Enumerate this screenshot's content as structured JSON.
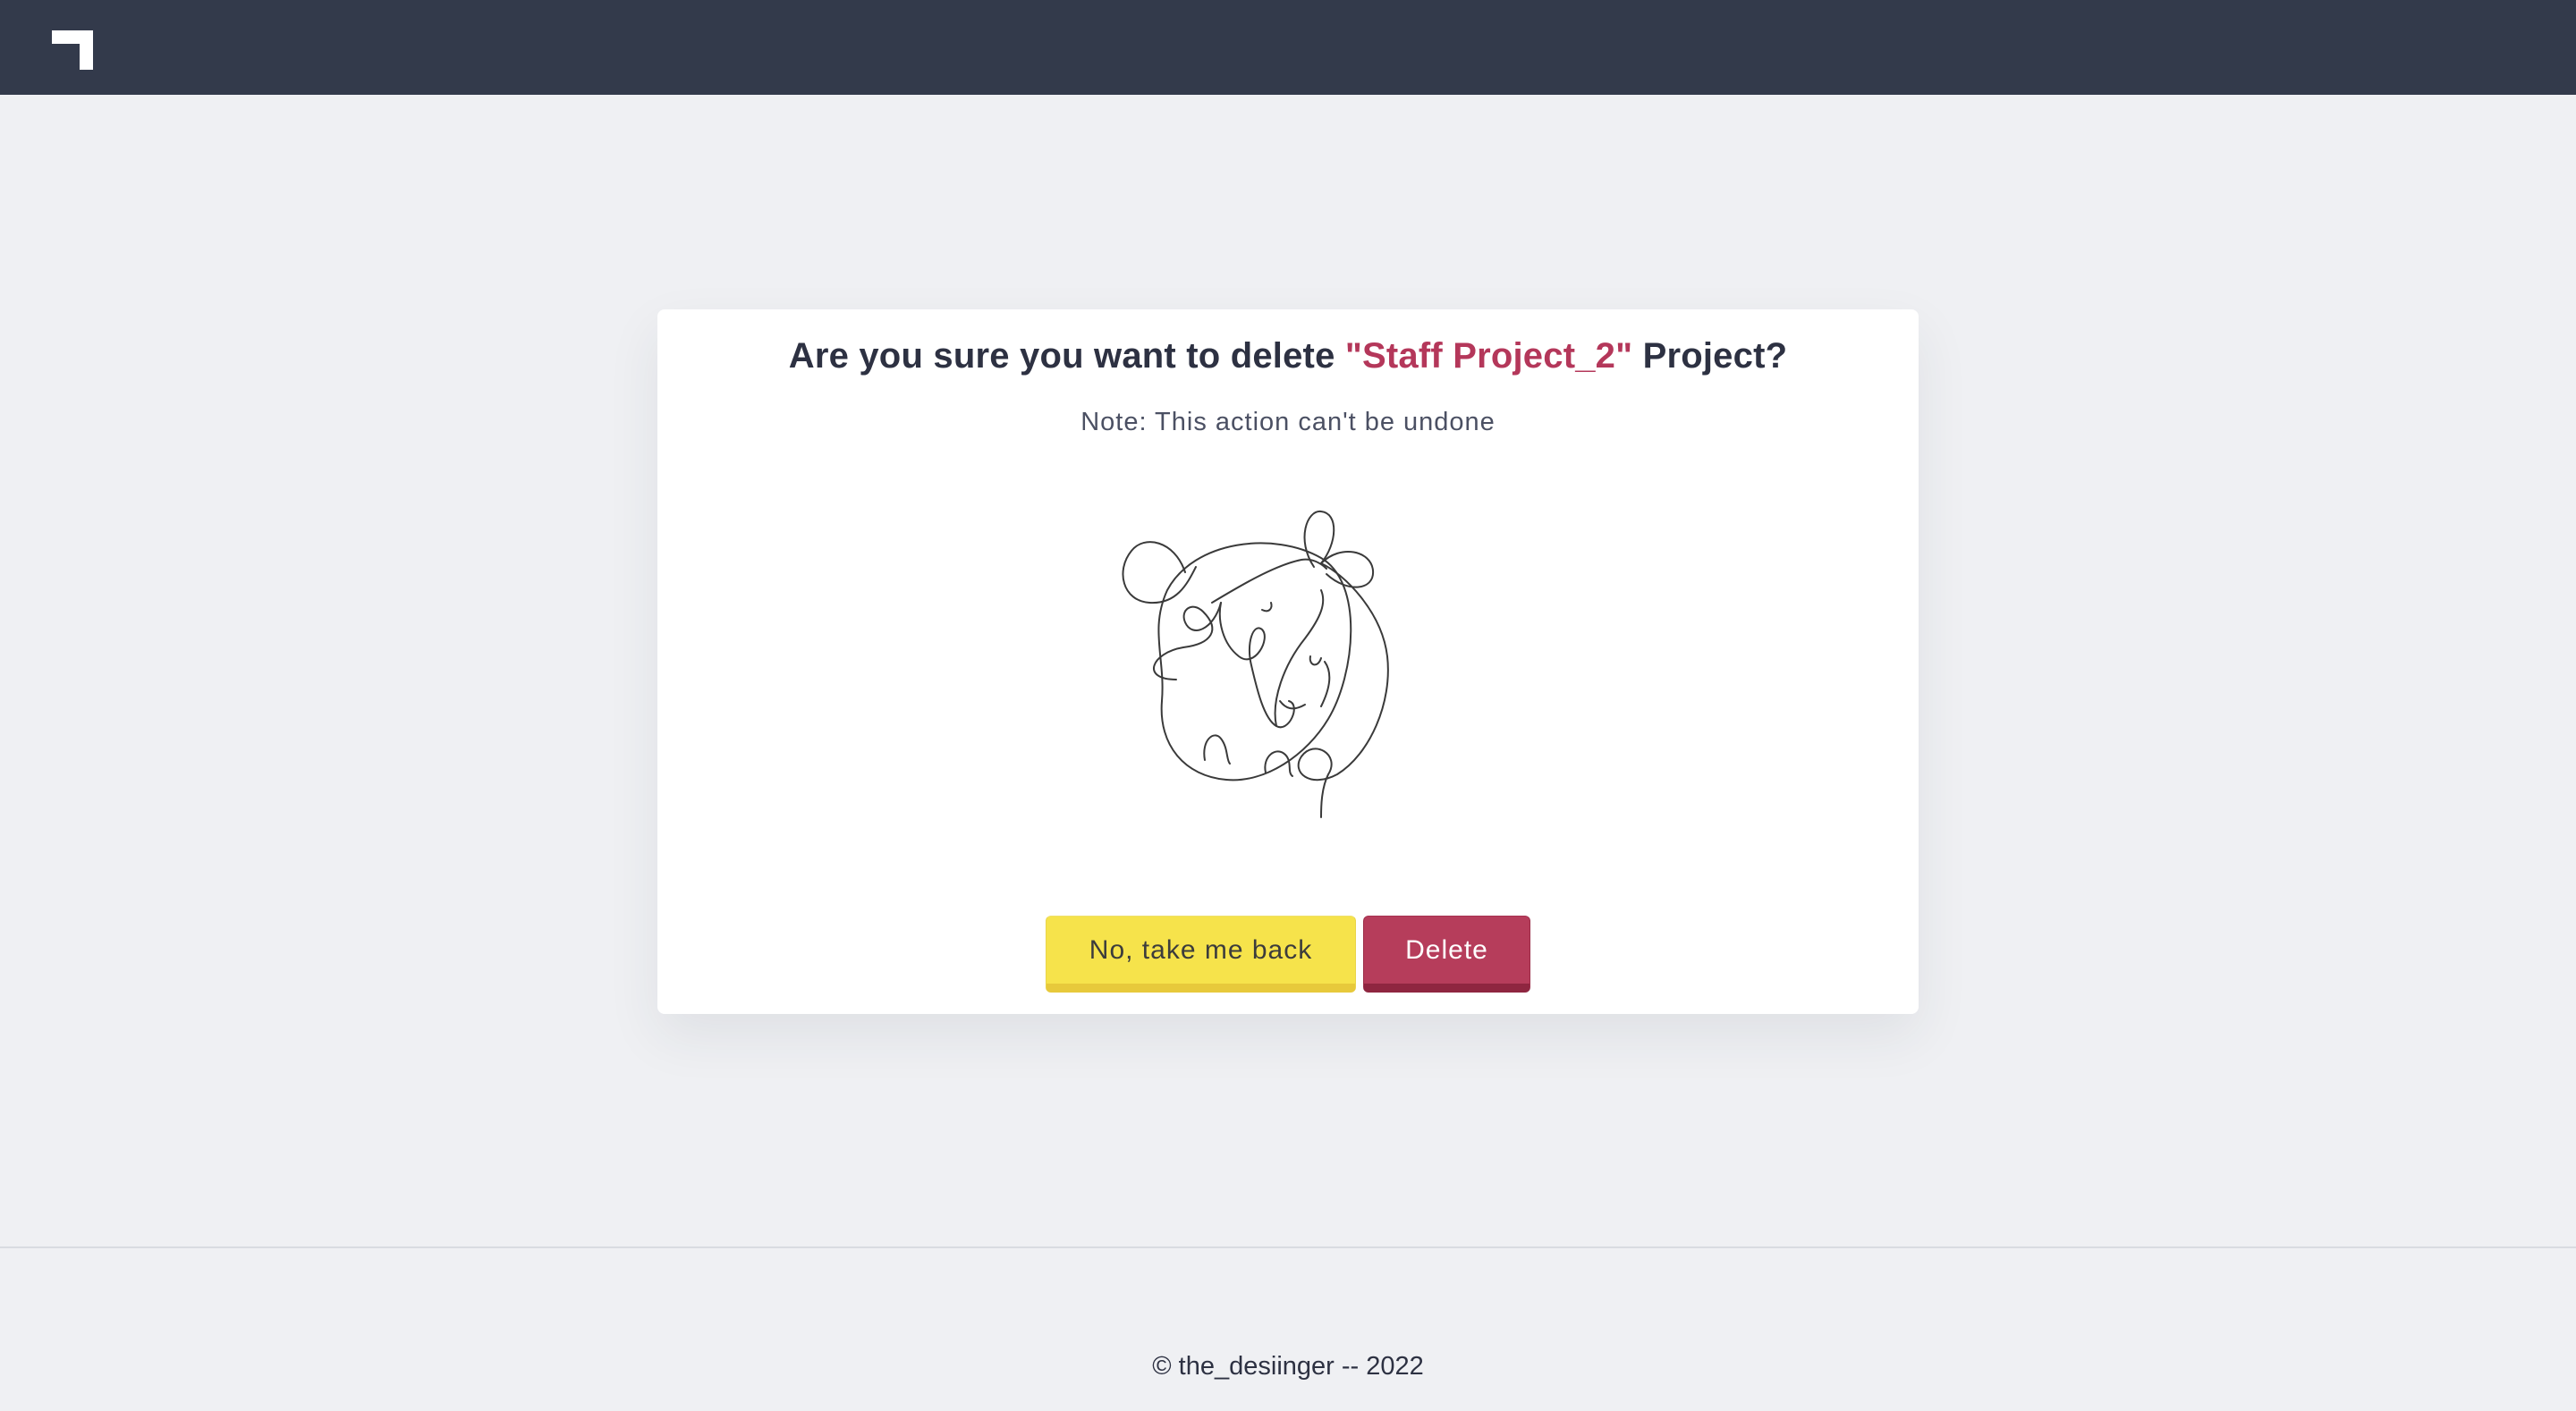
{
  "header": {
    "logo_icon": "corner-bracket-logo-icon",
    "bg_color": "#333a4b"
  },
  "dialog": {
    "title_prefix": "Are you sure you want to delete ",
    "project_name": "\"Staff Project_2\"",
    "title_suffix": " Project?",
    "note": "Note: This action can't be undone",
    "illustration_icon": "scribble-line-art-icon",
    "buttons": {
      "back_label": "No, take me back",
      "delete_label": "Delete"
    },
    "colors": {
      "accent": "#b4375a",
      "back_button": "#f6e34b",
      "delete_button": "#b63d5b"
    }
  },
  "footer": {
    "text": "© the_desiinger -- 2022"
  }
}
